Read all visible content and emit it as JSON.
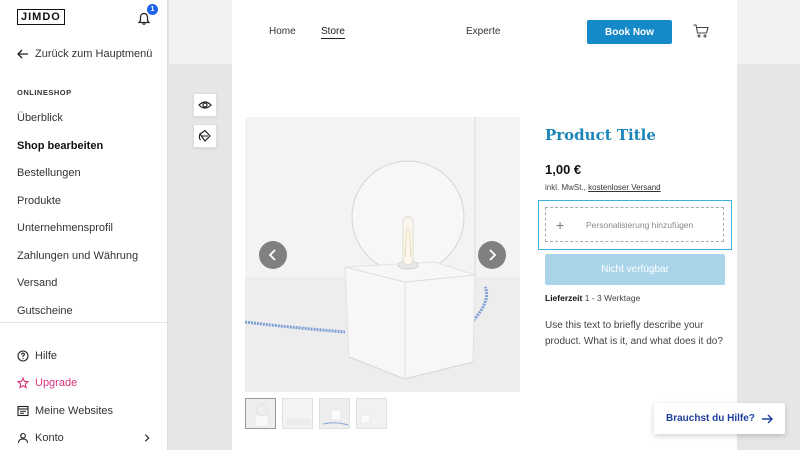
{
  "sidebar": {
    "logo": "JIMDO",
    "notification_count": "1",
    "back_label": "Zurück zum Hauptmenü",
    "section_title": "ONLINESHOP",
    "items": [
      {
        "label": "Überblick"
      },
      {
        "label": "Shop bearbeiten",
        "active": true
      },
      {
        "label": "Bestellungen"
      },
      {
        "label": "Produkte"
      },
      {
        "label": "Unternehmensprofil"
      },
      {
        "label": "Zahlungen und Währung"
      },
      {
        "label": "Versand"
      },
      {
        "label": "Gutscheine"
      }
    ],
    "bottom": {
      "help": "Hilfe",
      "upgrade": "Upgrade",
      "my_websites": "Meine Websites",
      "account": "Konto"
    }
  },
  "site_nav": {
    "home": "Home",
    "store": "Store",
    "experte": "Experte",
    "book_now": "Book Now"
  },
  "product": {
    "title": "Product Title",
    "price": "1,00 €",
    "tax_note": "inkl. MwSt., ",
    "shipping_link": "kostenloser Versand",
    "personalization": "Personalisierung hinzufügen",
    "unavailable_button": "Nicht verfügbar",
    "delivery_label": "Lieferzeit",
    "delivery_value": "1 - 3 Werktage",
    "description": "Use this text to briefly describe your product. What is it, and what does it do?"
  },
  "help_widget": {
    "label": "Brauchst du Hilfe?"
  },
  "colors": {
    "accent": "#1689c8",
    "title": "#1a85b8",
    "upgrade": "#d9337a",
    "badge": "#1e62e6"
  }
}
